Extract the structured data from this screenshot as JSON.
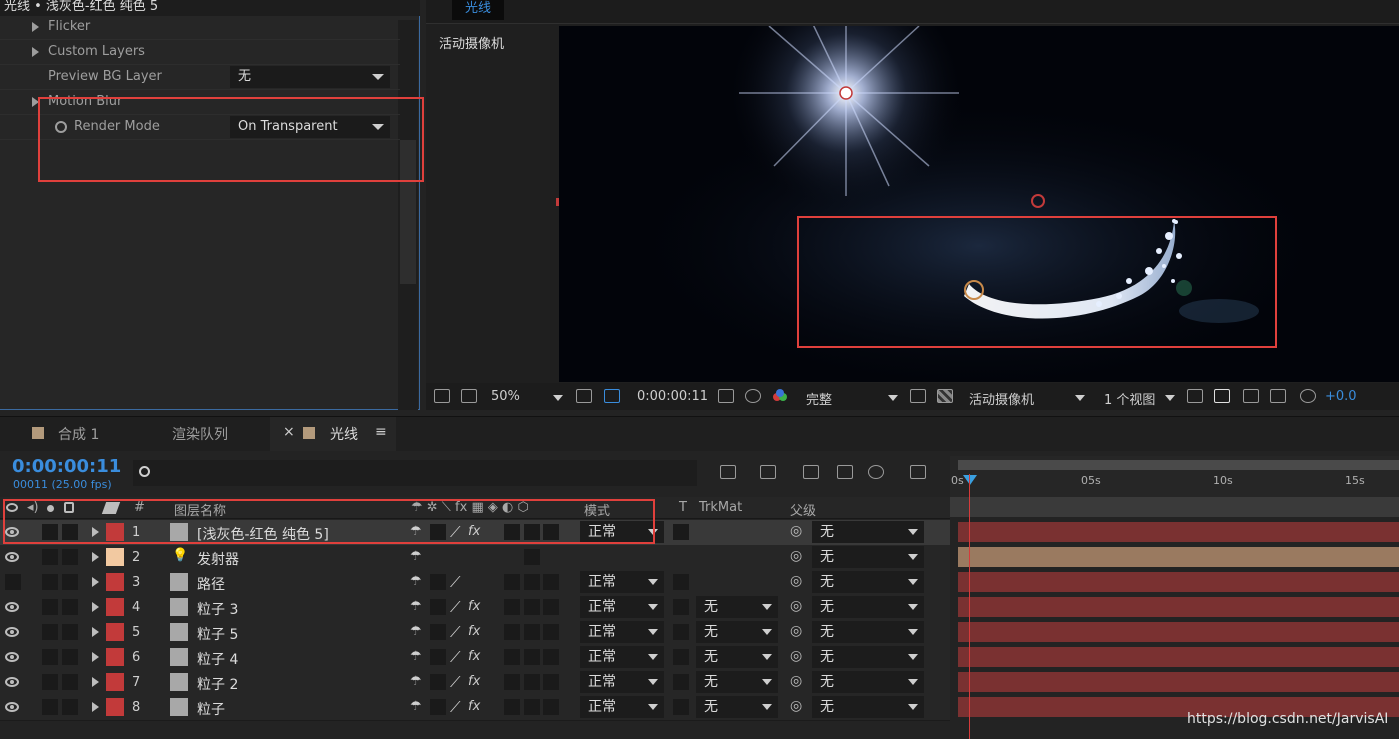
{
  "effect_controls": {
    "title": "光线 • 浅灰色-红色 纯色 5",
    "rows": [
      {
        "label": "Flicker"
      },
      {
        "label": "Custom Layers"
      },
      {
        "label": "Preview BG Layer",
        "value": "无"
      },
      {
        "label": "Motion Blur"
      },
      {
        "label": "Render Mode",
        "value": "On Transparent"
      }
    ]
  },
  "viewer": {
    "tab": "光线",
    "camera_label": "活动摄像机",
    "toolbar": {
      "zoom": "50%",
      "timecode": "0:00:00:11",
      "resolution": "完整",
      "camera": "活动摄像机",
      "views": "1 个视图",
      "exposure": "+0.0"
    }
  },
  "timeline": {
    "tabs": [
      "合成 1",
      "渲染队列",
      "光线"
    ],
    "timecode": "0:00:00:11",
    "frames": "00011 (25.00 fps)",
    "headers": {
      "num": "#",
      "name": "图层名称",
      "mode": "模式",
      "t": "T",
      "trkmat": "TrkMat",
      "parent": "父级"
    },
    "ruler": [
      "0s",
      "05s",
      "10s",
      "15s"
    ],
    "layers": [
      {
        "num": "1",
        "name": "[浅灰色-红色 纯色 5]",
        "mode": "正常",
        "trkmat": "",
        "parent": "无",
        "label_color": "#c23a3a",
        "fx": true,
        "selected": true
      },
      {
        "num": "2",
        "name": "发射器",
        "mode": "",
        "trkmat": "",
        "parent": "无",
        "label_color": "#f2c9a1",
        "fx": false,
        "selected": false
      },
      {
        "num": "3",
        "name": "路径",
        "mode": "正常",
        "trkmat": "",
        "parent": "无",
        "label_color": "#c23a3a",
        "fx": false,
        "selected": false
      },
      {
        "num": "4",
        "name": "粒子 3",
        "mode": "正常",
        "trkmat": "无",
        "parent": "无",
        "label_color": "#c23a3a",
        "fx": true,
        "selected": false
      },
      {
        "num": "5",
        "name": "粒子 5",
        "mode": "正常",
        "trkmat": "无",
        "parent": "无",
        "label_color": "#c23a3a",
        "fx": true,
        "selected": false
      },
      {
        "num": "6",
        "name": "粒子 4",
        "mode": "正常",
        "trkmat": "无",
        "parent": "无",
        "label_color": "#c23a3a",
        "fx": true,
        "selected": false
      },
      {
        "num": "7",
        "name": "粒子 2",
        "mode": "正常",
        "trkmat": "无",
        "parent": "无",
        "label_color": "#c23a3a",
        "fx": true,
        "selected": false
      },
      {
        "num": "8",
        "name": "粒子",
        "mode": "正常",
        "trkmat": "无",
        "parent": "无",
        "label_color": "#c23a3a",
        "fx": true,
        "selected": false
      }
    ]
  },
  "watermark": "https://blog.csdn.net/JarvisAI",
  "colors": {
    "accent": "#3a8ddd",
    "highlight": "#e0403c",
    "bar_red": "#7a3131",
    "bar_tan": "#9a7a60"
  }
}
